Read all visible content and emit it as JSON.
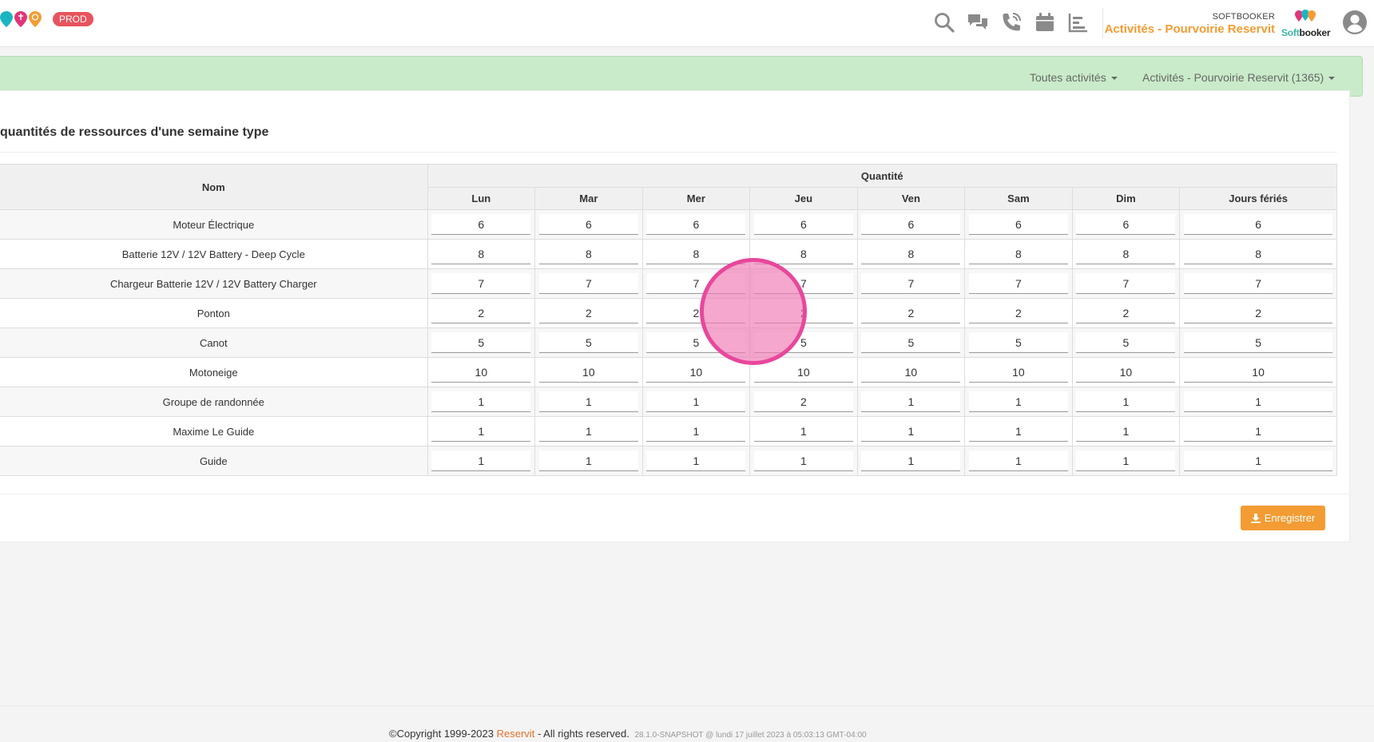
{
  "header": {
    "env_badge": "PROD",
    "brand_small": "SOFTBOOKER",
    "brand_title": "Activités - Pourvoirie Reservit",
    "logo_text_soft": "Soft",
    "logo_text_booker": "booker",
    "icons": [
      "search-icon",
      "chat-icon",
      "phone-icon",
      "calendar-icon",
      "chart-icon",
      "user-icon"
    ]
  },
  "nav": {
    "filter_activities": "Toutes activités",
    "organization": "Activités - Pourvoirie Reservit (1365)"
  },
  "panel": {
    "title": "quantités de ressources d'une semaine type",
    "save_label": "Enregistrer"
  },
  "table": {
    "name_header": "Nom",
    "quantity_header": "Quantité",
    "days": [
      "Lun",
      "Mar",
      "Mer",
      "Jeu",
      "Ven",
      "Sam",
      "Dim",
      "Jours fériés"
    ],
    "rows": [
      {
        "name": "Moteur Électrique",
        "values": [
          "6",
          "6",
          "6",
          "6",
          "6",
          "6",
          "6",
          "6"
        ]
      },
      {
        "name": "Batterie 12V / 12V Battery - Deep Cycle",
        "values": [
          "8",
          "8",
          "8",
          "8",
          "8",
          "8",
          "8",
          "8"
        ]
      },
      {
        "name": "Chargeur Batterie 12V / 12V Battery Charger",
        "values": [
          "7",
          "7",
          "7",
          "7",
          "7",
          "7",
          "7",
          "7"
        ]
      },
      {
        "name": "Ponton",
        "values": [
          "2",
          "2",
          "2",
          "2",
          "2",
          "2",
          "2",
          "2"
        ]
      },
      {
        "name": "Canot",
        "values": [
          "5",
          "5",
          "5",
          "5",
          "5",
          "5",
          "5",
          "5"
        ]
      },
      {
        "name": "Motoneige",
        "values": [
          "10",
          "10",
          "10",
          "10",
          "10",
          "10",
          "10",
          "10"
        ]
      },
      {
        "name": "Groupe de randonnée",
        "values": [
          "1",
          "1",
          "1",
          "2",
          "1",
          "1",
          "1",
          "1"
        ]
      },
      {
        "name": "Maxime Le Guide",
        "values": [
          "1",
          "1",
          "1",
          "1",
          "1",
          "1",
          "1",
          "1"
        ]
      },
      {
        "name": "Guide",
        "values": [
          "1",
          "1",
          "1",
          "1",
          "1",
          "1",
          "1",
          "1"
        ]
      }
    ]
  },
  "footer": {
    "copyright": "©Copyright 1999-2023",
    "brand": "Reservit",
    "rights": "- All rights reserved.",
    "version": "28.1.0-SNAPSHOT @ lundi 17 juillet 2023 à 05:03:13 GMT-04:00"
  },
  "colors": {
    "accent": "#f39c33",
    "nav_bg": "#c9ebc9",
    "badge": "#e8535d",
    "click_marker": "#e8479b"
  }
}
